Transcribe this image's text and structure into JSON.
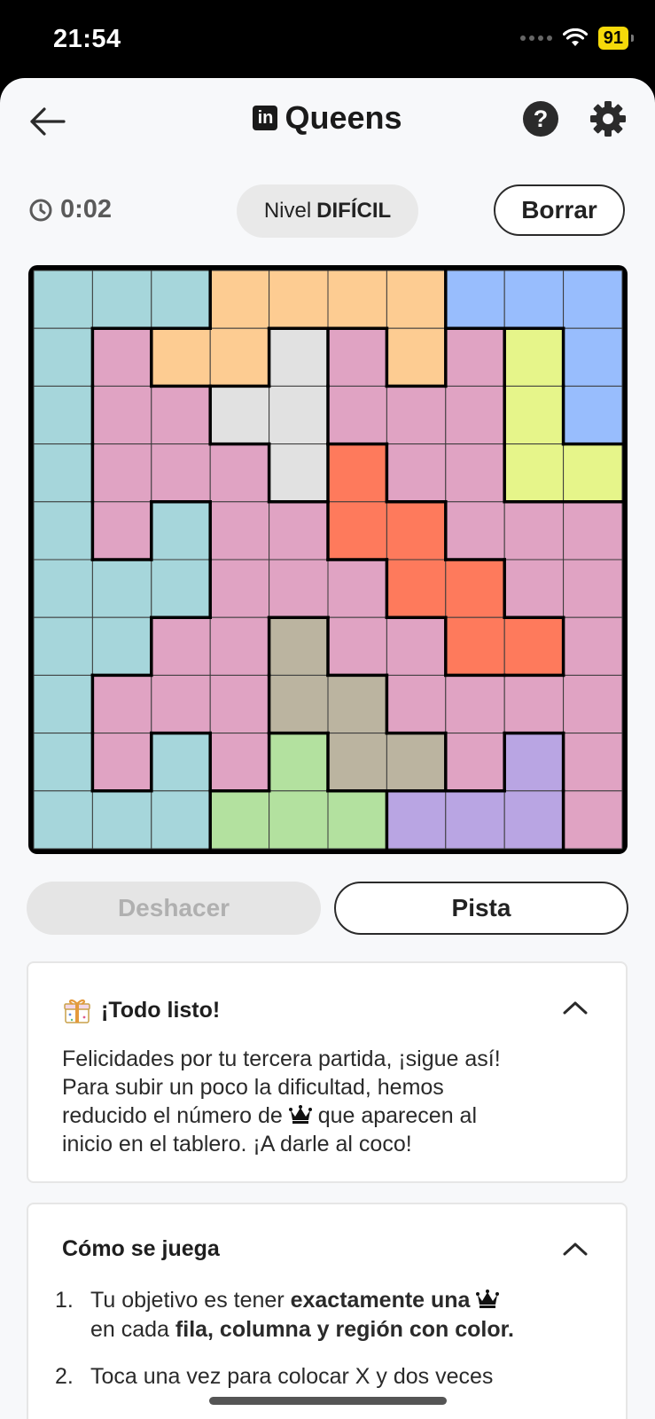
{
  "status_bar": {
    "time": "21:54",
    "battery": "91"
  },
  "header": {
    "title": "Queens",
    "logo_text": "in",
    "back_icon": "arrow-left-icon",
    "help_label": "?",
    "settings_icon": "gear-icon"
  },
  "game": {
    "timer": "0:02",
    "level_prefix": "Nivel",
    "level_value": "DIFÍCIL",
    "clear_label": "Borrar",
    "grid_size": 10,
    "regions": [
      "AAAOOOOBBB",
      "APOOGPOPYB",
      "APPGGPPPYB",
      "APPPGRPPYY",
      "APAPPRRPPP",
      "AAAPPPRRPP",
      "AAPPTPPRRP",
      "APPPTTPPPP",
      "APAPLTTPVP",
      "AAALLLVVVP"
    ],
    "colors": {
      "A": "#a6d6db",
      "O": "#fdcc92",
      "B": "#98bdfd",
      "P": "#e0a3c3",
      "G": "#e1e1e1",
      "Y": "#e6f58a",
      "R": "#fe7a5c",
      "T": "#bbb4a0",
      "L": "#b3e19f",
      "V": "#b9a5e3"
    }
  },
  "actions": {
    "undo_label": "Deshacer",
    "hint_label": "Pista"
  },
  "done_card": {
    "title": "¡Todo listo!",
    "line1": "Felicidades por tu tercera partida, ¡sigue así!",
    "line2": "Para subir un poco la dificultad, hemos",
    "line3_before": "reducido el número de",
    "line3_after": "que aparecen al",
    "line4": "inicio en el tablero. ¡A darle al coco!"
  },
  "how_card": {
    "title": "Cómo se juega",
    "item1_num": "1.",
    "item1_a": "Tu objetivo es tener",
    "item1_b": "exactamente una",
    "item1_c": "en cada",
    "item1_d": "fila, columna y región con color.",
    "item2_num": "2.",
    "item2_text": "Toca una vez para colocar X y dos veces"
  }
}
